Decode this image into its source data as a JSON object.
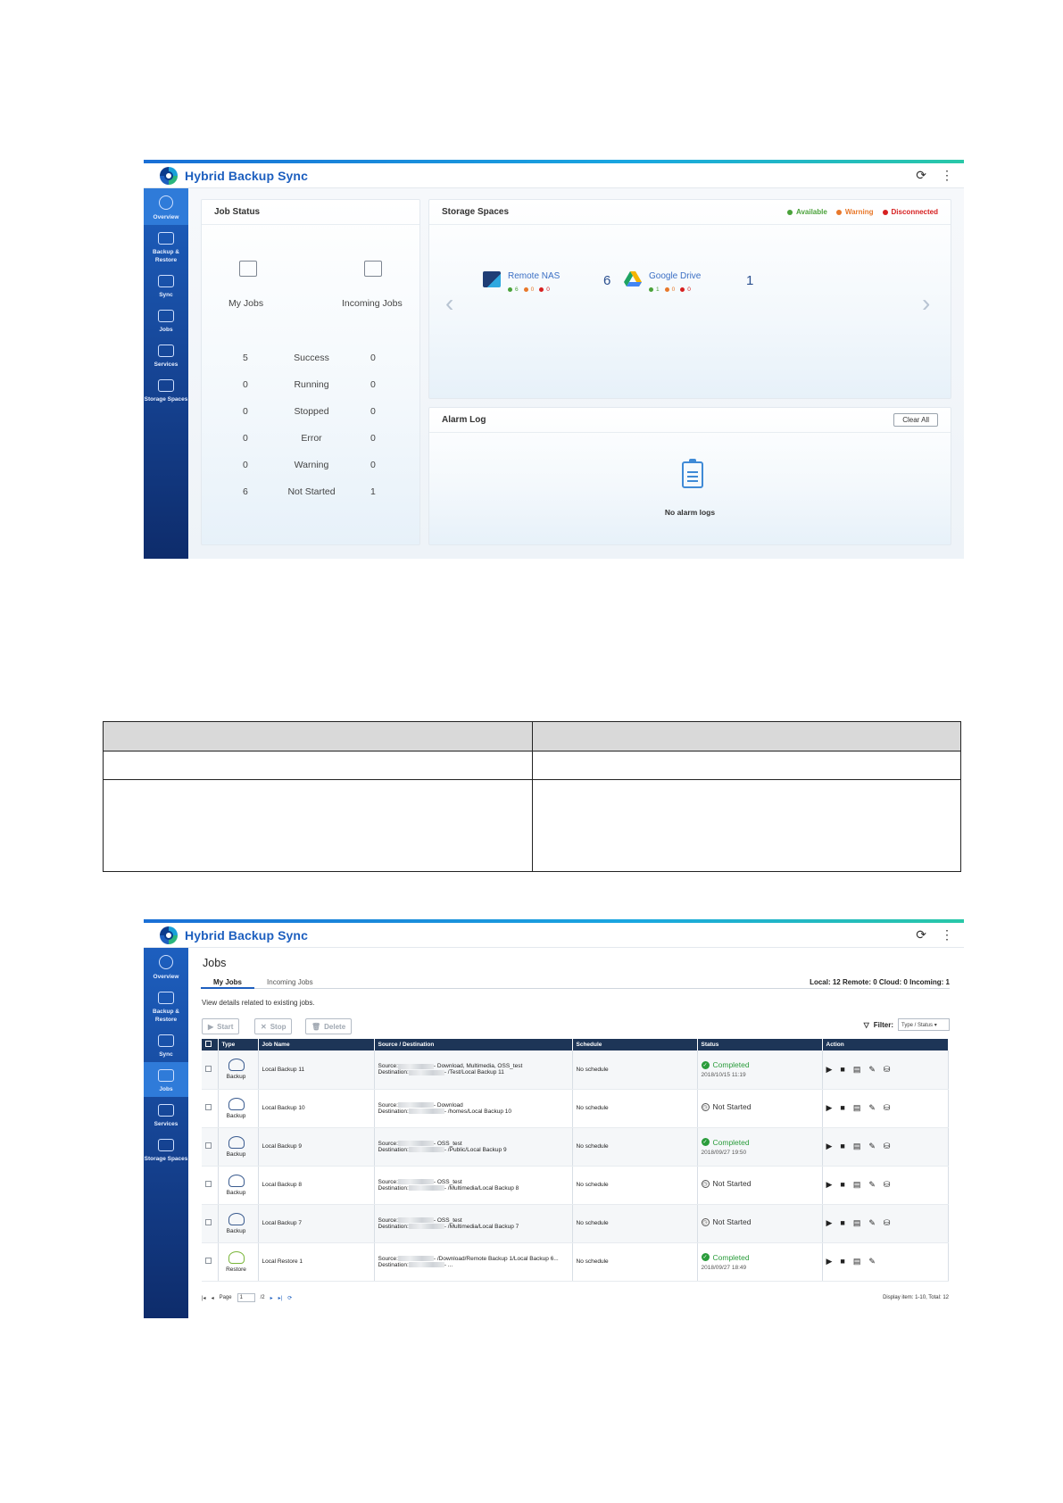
{
  "app": {
    "title": "Hybrid Backup Sync"
  },
  "sidebar": {
    "items": [
      {
        "label": "Overview"
      },
      {
        "label": "Backup & Restore"
      },
      {
        "label": "Sync"
      },
      {
        "label": "Jobs"
      },
      {
        "label": "Services"
      },
      {
        "label": "Storage Spaces"
      }
    ]
  },
  "overview": {
    "job_status": {
      "title": "Job Status",
      "my_jobs": "My Jobs",
      "incoming_jobs": "Incoming Jobs",
      "rows": [
        {
          "mine": "5",
          "label": "Success",
          "incoming": "0"
        },
        {
          "mine": "0",
          "label": "Running",
          "incoming": "0"
        },
        {
          "mine": "0",
          "label": "Stopped",
          "incoming": "0"
        },
        {
          "mine": "0",
          "label": "Error",
          "incoming": "0"
        },
        {
          "mine": "0",
          "label": "Warning",
          "incoming": "0"
        },
        {
          "mine": "6",
          "label": "Not Started",
          "incoming": "1"
        }
      ]
    },
    "storage": {
      "title": "Storage Spaces",
      "legend": [
        {
          "label": "Available",
          "color": "#4aa23a"
        },
        {
          "label": "Warning",
          "color": "#e8782a"
        },
        {
          "label": "Disconnected",
          "color": "#d62020"
        }
      ],
      "spaces": [
        {
          "name": "Remote NAS",
          "count": "6",
          "available": "6",
          "warning": "0",
          "disconnected": "0"
        },
        {
          "name": "Google Drive",
          "count": "1",
          "available": "1",
          "warning": "0",
          "disconnected": "0"
        }
      ]
    },
    "alarm": {
      "title": "Alarm Log",
      "clear": "Clear All",
      "empty": "No alarm logs"
    }
  },
  "jobs": {
    "title": "Jobs",
    "tabs": [
      "My Jobs",
      "Incoming Jobs"
    ],
    "counts": "Local: 12  Remote: 0  Cloud: 0  Incoming: 1",
    "hint": "View details related to existing jobs.",
    "buttons": {
      "start": "Start",
      "stop": "Stop",
      "delete": "Delete"
    },
    "filter": {
      "label": "Filter:",
      "value": "Type / Status"
    },
    "columns": [
      "Type",
      "Job Name",
      "Source / Destination",
      "Schedule",
      "Status",
      "Action"
    ],
    "rows": [
      {
        "type": "Backup",
        "name": "Local Backup 11",
        "source": "- Download, Multimedia, OSS_test",
        "dest": "- /Test/Local Backup 11",
        "schedule": "No schedule",
        "status": "Completed",
        "time": "2018/10/15 11:19"
      },
      {
        "type": "Backup",
        "name": "Local Backup 10",
        "source": "- Download",
        "dest": "- /homes/Local Backup 10",
        "schedule": "No schedule",
        "status": "Not Started",
        "time": ""
      },
      {
        "type": "Backup",
        "name": "Local Backup 9",
        "source": "- OSS_test",
        "dest": "- /Public/Local Backup 9",
        "schedule": "No schedule",
        "status": "Completed",
        "time": "2018/09/27 19:50"
      },
      {
        "type": "Backup",
        "name": "Local Backup 8",
        "source": "- OSS_test",
        "dest": "- /Multimedia/Local Backup 8",
        "schedule": "No schedule",
        "status": "Not Started",
        "time": ""
      },
      {
        "type": "Backup",
        "name": "Local Backup 7",
        "source": "- OSS_test",
        "dest": "- /Multimedia/Local Backup 7",
        "schedule": "No schedule",
        "status": "Not Started",
        "time": ""
      },
      {
        "type": "Restore",
        "name": "Local Restore 1",
        "source": "- /Download/Remote Backup 1/Local Backup 6...",
        "dest": "- ...",
        "schedule": "No schedule",
        "status": "Completed",
        "time": "2018/09/27 18:49"
      }
    ],
    "pager": {
      "page_label": "Page",
      "page": "1",
      "of": "/2",
      "display": "Display item: 1-10, Total: 12"
    },
    "source_label": "Source:",
    "dest_label": "Destination:"
  }
}
